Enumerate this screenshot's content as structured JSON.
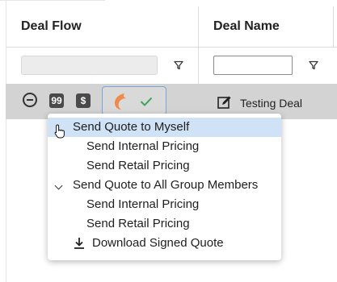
{
  "table": {
    "columns": [
      {
        "label": "Deal Flow"
      },
      {
        "label": "Deal Name"
      }
    ],
    "row": {
      "deal_name": "Testing Deal",
      "quote_chip": "99",
      "dollar_chip": "$"
    }
  },
  "menu": {
    "items": [
      {
        "label": "Send Quote to Myself"
      },
      {
        "label": "Send Internal Pricing"
      },
      {
        "label": "Send Retail Pricing"
      },
      {
        "label": "Send Quote to All Group Members"
      },
      {
        "label": "Send Internal Pricing"
      },
      {
        "label": "Send Retail Pricing"
      },
      {
        "label": "Download Signed Quote"
      }
    ]
  },
  "colors": {
    "highlight": "#cfe2f6",
    "row_selected": "#d3d3d3",
    "accent_orange": "#f08a4b",
    "check_green": "#3aa655"
  }
}
